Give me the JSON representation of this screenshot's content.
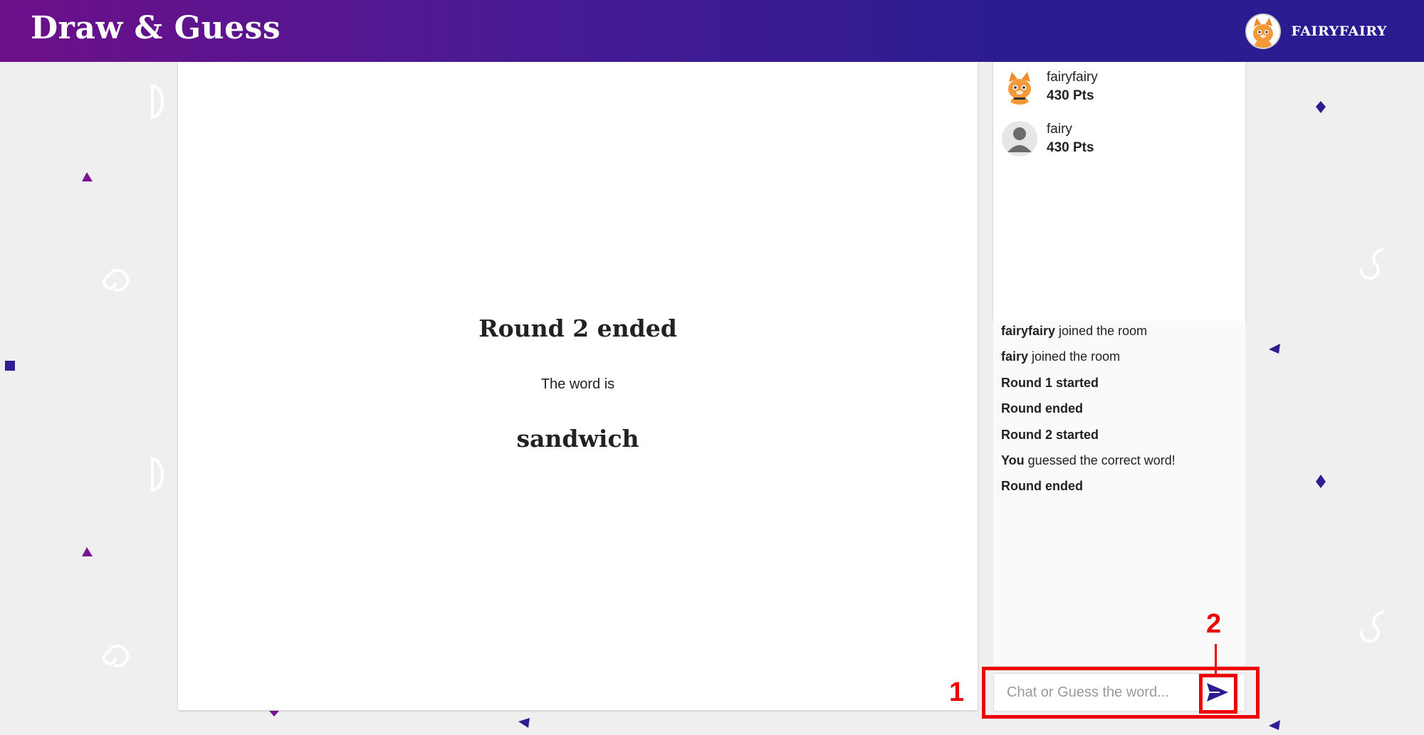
{
  "header": {
    "brand": "Draw & Guess",
    "username": "FAIRYFAIRY"
  },
  "game": {
    "round_title": "Round 2 ended",
    "word_intro": "The word is",
    "word": "sandwich"
  },
  "players": [
    {
      "name": "fairyfairy",
      "points": "430 Pts",
      "avatar": "cat-avatar-icon"
    },
    {
      "name": "fairy",
      "points": "430 Pts",
      "avatar": "default-user-icon"
    }
  ],
  "chat": {
    "messages": [
      {
        "bold": "fairyfairy",
        "text": " joined the room"
      },
      {
        "bold": "fairy",
        "text": " joined the room"
      },
      {
        "bold": "Round 1 started",
        "text": ""
      },
      {
        "bold": "Round ended",
        "text": ""
      },
      {
        "bold": "Round 2 started",
        "text": ""
      },
      {
        "bold": "You",
        "text": " guessed the correct word!"
      },
      {
        "bold": "Round ended",
        "text": ""
      }
    ],
    "input_placeholder": "Chat or Guess the word...",
    "send_icon": "send-icon"
  },
  "annotations": {
    "label_1": "1",
    "label_2": "2",
    "color": "#ee0000"
  },
  "colors": {
    "header_start": "#6d0f8a",
    "header_end": "#2a1b90",
    "accent": "#2c1c92"
  }
}
